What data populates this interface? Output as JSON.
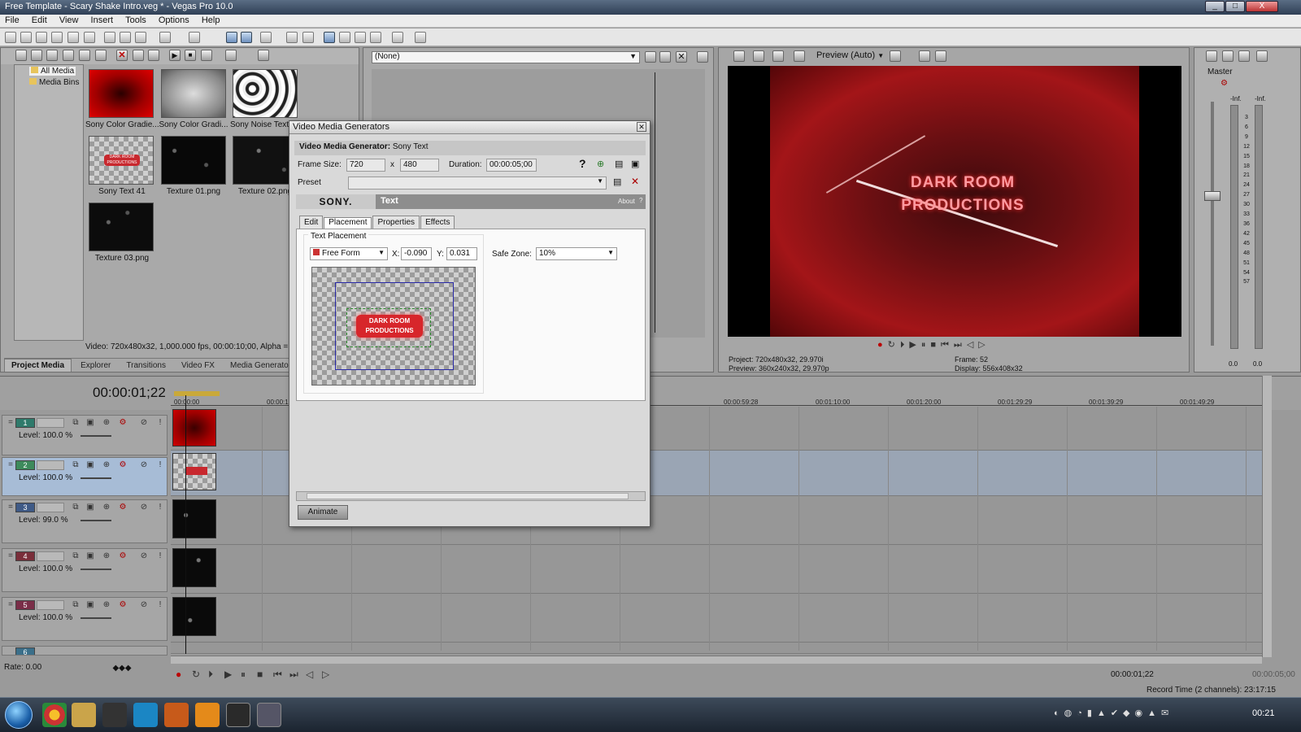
{
  "window": {
    "title": "Free Template - Scary Shake Intro.veg * - Vegas Pro 10.0",
    "minimize": "_",
    "maximize": "□",
    "close": "X"
  },
  "menu": [
    "File",
    "Edit",
    "View",
    "Insert",
    "Tools",
    "Options",
    "Help"
  ],
  "explorer_tree": {
    "all_media": "All Media",
    "media_bins": "Media Bins"
  },
  "media_items": [
    {
      "label": "Sony Color Gradie...",
      "kind": "red-gradient"
    },
    {
      "label": "Sony Color Gradi...",
      "kind": "gray-gradient"
    },
    {
      "label": "Sony Noise Textu...",
      "kind": "noise"
    },
    {
      "label": "Sony Text 41",
      "kind": "text"
    },
    {
      "label": "Texture 01.png",
      "kind": "dark-texture"
    },
    {
      "label": "Texture 02.png",
      "kind": "dark-texture"
    },
    {
      "label": "Texture 03.png",
      "kind": "dark-texture"
    }
  ],
  "media_info": "Video: 720x480x32, 1,000.000 fps, 00:00:10;00, Alpha = Prem",
  "window_docking_tabs": [
    "Project Media",
    "Explorer",
    "Transitions",
    "Video FX",
    "Media Generators"
  ],
  "trimmer": {
    "dropdown": "(None)"
  },
  "preview": {
    "mode": "Preview (Auto)",
    "overlay_line1": "DARK ROOM",
    "overlay_line2": "PRODUCTIONS",
    "project_label": "Project:",
    "project_value": "720x480x32, 29.970i",
    "preview_label": "Preview:",
    "preview_value": "360x240x32, 29.970p",
    "frame_label": "Frame:",
    "frame_value": "52",
    "display_label": "Display:",
    "display_value": "556x408x32"
  },
  "master": {
    "label": "Master",
    "inf_left": "-Inf.",
    "inf_right": "-Inf.",
    "scale": [
      "3",
      "6",
      "9",
      "12",
      "15",
      "18",
      "21",
      "24",
      "27",
      "30",
      "33",
      "36",
      "42",
      "45",
      "48",
      "51",
      "54",
      "57"
    ],
    "bottom_left": "0.0",
    "bottom_right": "0.0"
  },
  "dialog": {
    "title": "Video Media Generators",
    "generator_label": "Video Media Generator:",
    "generator_value": "Sony Text",
    "frame_size_label": "Frame Size:",
    "frame_w": "720",
    "frame_x": "x",
    "frame_h": "480",
    "duration_label": "Duration:",
    "duration_value": "00:00:05;00",
    "preset_label": "Preset",
    "preset_value": "",
    "brand": "SONY.",
    "plugin_name": "Text",
    "about": "About",
    "help": "?",
    "tabs": [
      "Edit",
      "Placement",
      "Properties",
      "Effects"
    ],
    "active_tab": "Placement",
    "text_placement_label": "Text Placement",
    "placement_mode": "Free Form",
    "x_label": "X:",
    "x_value": "-0.090",
    "y_label": "Y:",
    "y_value": "0.031",
    "safe_zone_label": "Safe Zone:",
    "safe_zone_value": "10%",
    "preview_line1": "DARK ROOM",
    "preview_line2": "PRODUCTIONS",
    "animate": "Animate"
  },
  "timeline": {
    "timecode": "00:00:01;22",
    "ruler": [
      "00:00:00",
      "00:00:10",
      "00:00:59:28",
      "00:01:10:00",
      "00:01:20:00",
      "00:01:29:29",
      "00:01:39:29",
      "00:01:49:29"
    ],
    "level_label": "Level:",
    "tracks": [
      {
        "num": "1",
        "level": "100.0 %",
        "color": "#2f7a6b",
        "clip": "red"
      },
      {
        "num": "2",
        "level": "100.0 %",
        "color": "#3d8a5c",
        "clip": "text"
      },
      {
        "num": "3",
        "level": "99.0 %",
        "color": "#3f5a86",
        "clip": "dark"
      },
      {
        "num": "4",
        "level": "100.0 %",
        "color": "#7a2e3a",
        "clip": "dark"
      },
      {
        "num": "5",
        "level": "100.0 %",
        "color": "#7a2e48",
        "clip": "dark"
      },
      {
        "num": "6",
        "level": "",
        "color": "#3b6f8a",
        "clip": "dark"
      }
    ],
    "rate": "Rate: 0.00",
    "cursor_time": "00:00:01;22",
    "end_time": "00:00:05;00",
    "record_time": "Record Time (2 channels): 23:17:15"
  },
  "taskbar": {
    "clock": "00:21"
  }
}
